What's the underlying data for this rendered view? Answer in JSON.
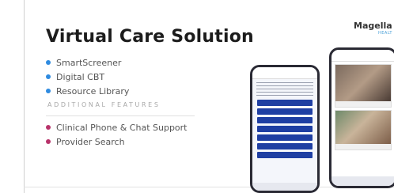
{
  "slide": {
    "title": "Virtual Care Solution",
    "features": [
      "SmartScreener",
      "Digital CBT",
      "Resource Library"
    ],
    "additional_heading": "ADDITIONAL FEATURES",
    "additional_features": [
      "Clinical Phone & Chat Support",
      "Provider Search"
    ],
    "logo_text": "Magella",
    "logo_sub": "HEALT"
  },
  "colors": {
    "primary_dot": "#2f8be0",
    "secondary_dot": "#b8336a",
    "phone_button": "#1f3fa3"
  }
}
